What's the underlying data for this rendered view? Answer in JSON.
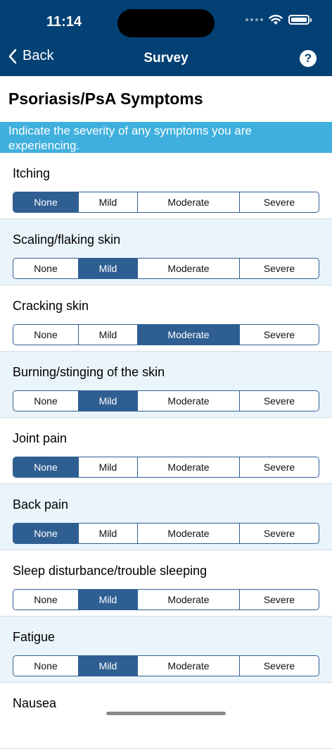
{
  "status_bar": {
    "time": "11:14"
  },
  "nav": {
    "back_label": "Back",
    "title": "Survey",
    "help_label": "?"
  },
  "page_title": "Psoriasis/PsA Symptoms",
  "instruction": "Indicate the severity of any symptoms you are experiencing.",
  "severity_options": [
    "None",
    "Mild",
    "Moderate",
    "Severe"
  ],
  "symptoms": [
    {
      "label": "Itching",
      "selected": "None"
    },
    {
      "label": "Scaling/flaking skin",
      "selected": "Mild"
    },
    {
      "label": "Cracking skin",
      "selected": "Moderate"
    },
    {
      "label": "Burning/stinging of the skin",
      "selected": "Mild"
    },
    {
      "label": "Joint pain",
      "selected": "None"
    },
    {
      "label": "Back pain",
      "selected": "None"
    },
    {
      "label": "Sleep disturbance/trouble sleeping",
      "selected": "Mild"
    },
    {
      "label": "Fatigue",
      "selected": "Mild"
    },
    {
      "label": "Nausea",
      "selected": ""
    }
  ],
  "colors": {
    "header": "#034074",
    "banner": "#3fb0de",
    "selected": "#2f5f92",
    "alt_row": "#eaf4fb"
  }
}
